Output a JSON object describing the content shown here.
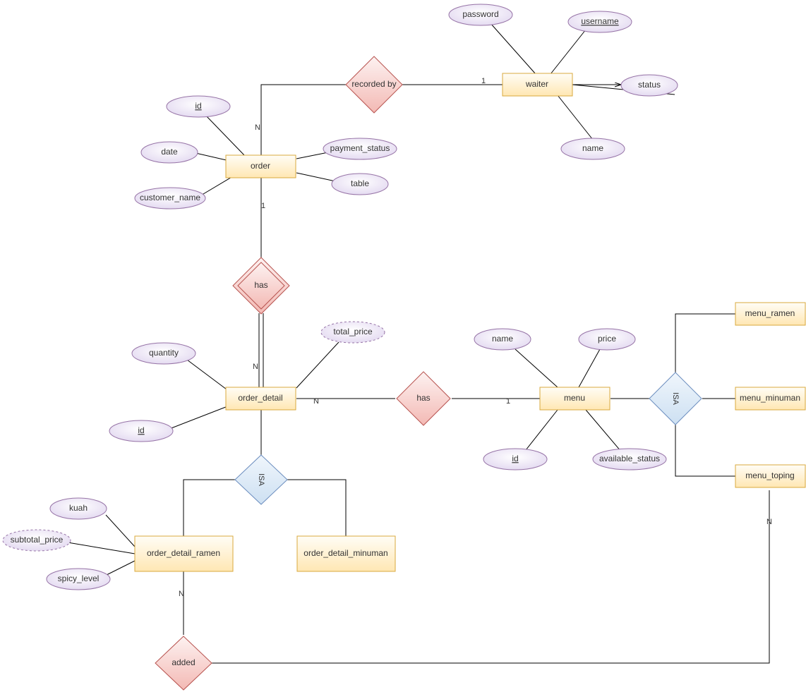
{
  "entities": {
    "waiter": "waiter",
    "order": "order",
    "order_detail": "order_detail",
    "menu": "menu",
    "menu_ramen": "menu_ramen",
    "menu_minuman": "menu_minuman",
    "menu_toping": "menu_toping",
    "order_detail_ramen": "order_detail_ramen",
    "order_detail_minuman": "order_detail_minuman"
  },
  "attributes": {
    "waiter_password": "password",
    "waiter_username": "username",
    "waiter_status": "status",
    "waiter_name": "name",
    "order_id": "id",
    "order_date": "date",
    "order_customer_name": "customer_name",
    "order_payment_status": "payment_status",
    "order_table": "table",
    "od_quantity": "quantity",
    "od_id": "id",
    "od_total_price": "total_price",
    "menu_name": "name",
    "menu_price": "price",
    "menu_id": "id",
    "menu_available_status": "available_status",
    "odr_kuah": "kuah",
    "odr_subtotal_price": "subtotal_price",
    "odr_spicy_level": "spicy_level"
  },
  "relationships": {
    "recorded_by": "recorded by",
    "has1": "has",
    "has2": "has",
    "added": "added"
  },
  "isa": "ISA",
  "cardinalities": {
    "recorded_by_waiter": "1",
    "recorded_by_order": "N",
    "has1_order": "1",
    "has1_od": "N",
    "has2_od": "N",
    "has2_menu": "1",
    "added_odr": "N",
    "added_toping": "N"
  }
}
